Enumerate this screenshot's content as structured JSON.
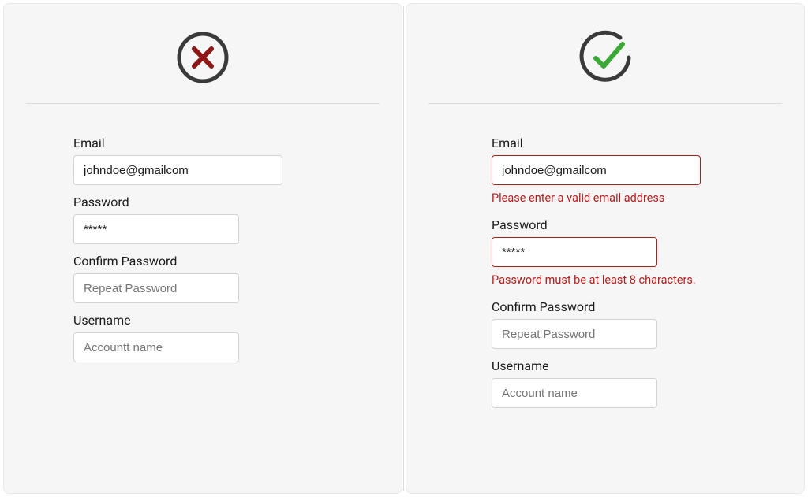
{
  "colors": {
    "error": "#b71c1c",
    "ok_stroke": "#3a3a3a",
    "ok_accent": "#3aa935",
    "x_stroke": "#3a3a3a",
    "x_mark": "#8e1616"
  },
  "left": {
    "status_icon": "x-circle",
    "fields": {
      "email_label": "Email",
      "email_value": "johndoe@gmailcom",
      "password_label": "Password",
      "password_value": "*****",
      "confirm_label": "Confirm Password",
      "confirm_placeholder": "Repeat Password",
      "username_label": "Username",
      "username_placeholder": "Accountt name"
    }
  },
  "right": {
    "status_icon": "check-circle",
    "fields": {
      "email_label": "Email",
      "email_value": "johndoe@gmailcom",
      "email_error": "Please enter a valid email address",
      "password_label": "Password",
      "password_value": "*****",
      "password_error": "Password must be at least 8 characters.",
      "confirm_label": "Confirm Password",
      "confirm_placeholder": "Repeat Password",
      "username_label": "Username",
      "username_placeholder": "Account name"
    }
  }
}
